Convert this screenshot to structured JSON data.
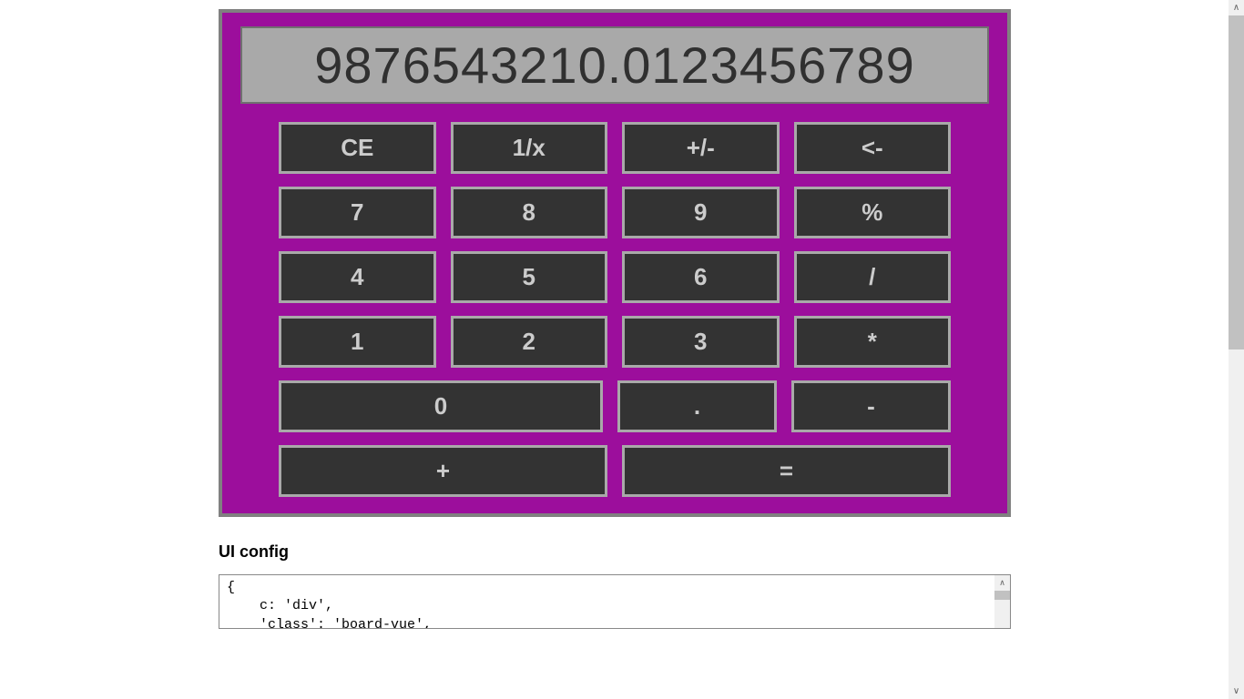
{
  "calculator": {
    "display": "9876543210.0123456789",
    "rows": [
      [
        {
          "label": "CE",
          "name": "clear-entry-button",
          "span": 1
        },
        {
          "label": "1/x",
          "name": "reciprocal-button",
          "span": 1
        },
        {
          "label": "+/-",
          "name": "sign-toggle-button",
          "span": 1
        },
        {
          "label": "<-",
          "name": "backspace-button",
          "span": 1
        }
      ],
      [
        {
          "label": "7",
          "name": "digit-7-button",
          "span": 1
        },
        {
          "label": "8",
          "name": "digit-8-button",
          "span": 1
        },
        {
          "label": "9",
          "name": "digit-9-button",
          "span": 1
        },
        {
          "label": "%",
          "name": "percent-button",
          "span": 1
        }
      ],
      [
        {
          "label": "4",
          "name": "digit-4-button",
          "span": 1
        },
        {
          "label": "5",
          "name": "digit-5-button",
          "span": 1
        },
        {
          "label": "6",
          "name": "digit-6-button",
          "span": 1
        },
        {
          "label": "/",
          "name": "divide-button",
          "span": 1
        }
      ],
      [
        {
          "label": "1",
          "name": "digit-1-button",
          "span": 1
        },
        {
          "label": "2",
          "name": "digit-2-button",
          "span": 1
        },
        {
          "label": "3",
          "name": "digit-3-button",
          "span": 1
        },
        {
          "label": "*",
          "name": "multiply-button",
          "span": 1
        }
      ],
      [
        {
          "label": "0",
          "name": "digit-0-button",
          "span": 2
        },
        {
          "label": ".",
          "name": "decimal-button",
          "span": 1
        },
        {
          "label": "-",
          "name": "subtract-button",
          "span": 1
        }
      ],
      [
        {
          "label": "+",
          "name": "add-button",
          "span": 2
        },
        {
          "label": "=",
          "name": "equals-button",
          "span": 2
        }
      ]
    ]
  },
  "config": {
    "heading": "UI config",
    "text": "{\n    c: 'div',\n    'class': 'board-vue',"
  },
  "colors": {
    "calculator_bg": "#9c0e9c",
    "button_bg": "#333333",
    "button_border": "#a9a9a9",
    "display_bg": "#a9a9a9"
  }
}
